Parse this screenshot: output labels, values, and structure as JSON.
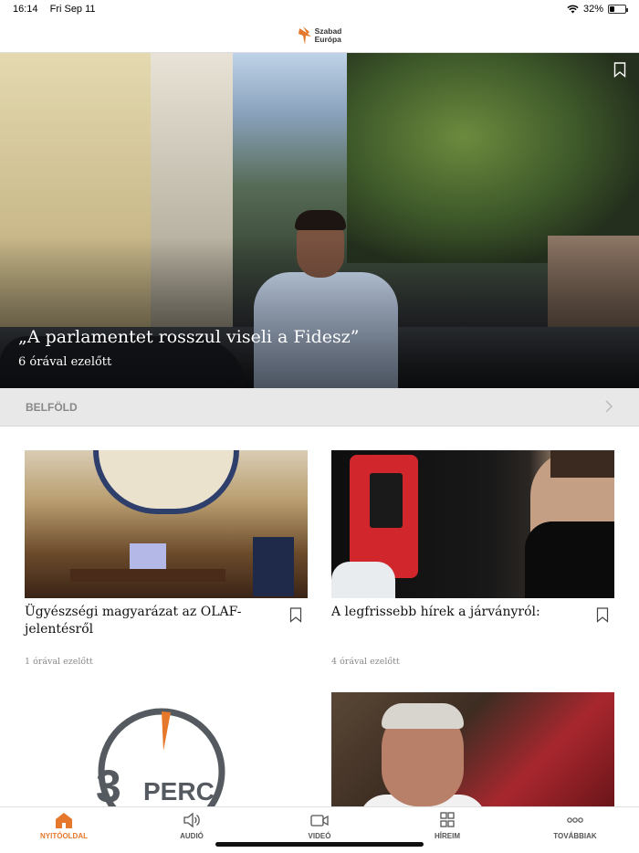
{
  "status_bar": {
    "time": "16:14",
    "date": "Fri Sep 11",
    "battery_percent": "32%",
    "battery_level": 0.32
  },
  "header": {
    "logo_line1": "Szabad",
    "logo_line2": "Európa",
    "brand_color": "#e6782b"
  },
  "hero": {
    "title": "„A parlamentet rosszul viseli a Fidesz”",
    "time": "6 órával ezelőtt"
  },
  "section": {
    "label": "BELFÖLD"
  },
  "articles": [
    {
      "title": "Ügyészségi magyarázat az OLAF-jelentésről",
      "time": "1 órával ezelőtt"
    },
    {
      "title": "A legfrissebb hírek a járványról:",
      "time": "4 órával ezelőtt"
    }
  ],
  "perc_logo": {
    "number": "3",
    "word": "PERC"
  },
  "tabs": [
    {
      "label": "NYITÓOLDAL",
      "icon": "home-icon",
      "active": true
    },
    {
      "label": "AUDIÓ",
      "icon": "speaker-icon",
      "active": false
    },
    {
      "label": "VIDEÓ",
      "icon": "video-camera-icon",
      "active": false
    },
    {
      "label": "HÍREIM",
      "icon": "grid-icon",
      "active": false
    },
    {
      "label": "TOVÁBBIAK",
      "icon": "more-dots-icon",
      "active": false
    }
  ]
}
